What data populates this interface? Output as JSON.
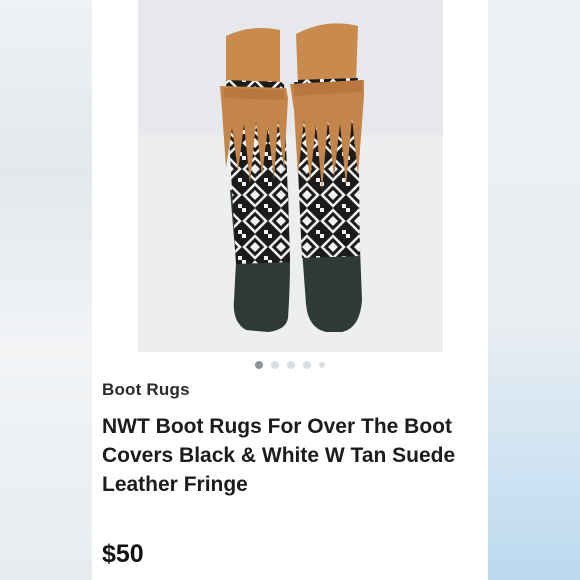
{
  "listing": {
    "brand": "Boot Rugs",
    "title": "NWT Boot Rugs For Over The Boot Covers Black & White W Tan Suede Leather Fringe",
    "price": "$50"
  },
  "carousel": {
    "image_count": 5,
    "active_index": 0
  },
  "colors": {
    "tan_suede": "#c9874a",
    "dark_suede": "#2f3a35",
    "pattern_black": "#1b1b1b",
    "pattern_white": "#f2f2f2"
  }
}
